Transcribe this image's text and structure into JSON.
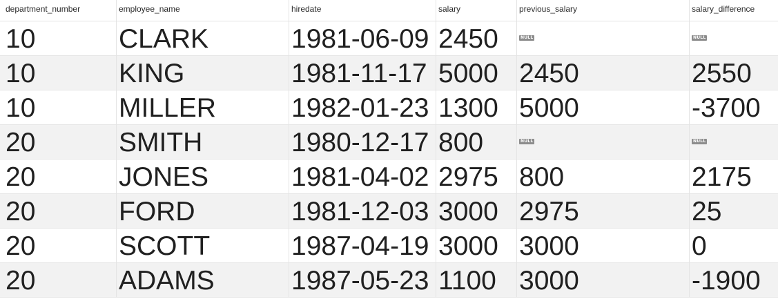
{
  "table": {
    "columns": [
      "department_number",
      "employee_name",
      "hiredate",
      "salary",
      "previous_salary",
      "salary_difference"
    ],
    "null_label": "NULL",
    "rows": [
      [
        "10",
        "CLARK",
        "1981-06-09",
        "2450",
        null,
        null
      ],
      [
        "10",
        "KING",
        "1981-11-17",
        "5000",
        "2450",
        "2550"
      ],
      [
        "10",
        "MILLER",
        "1982-01-23",
        "1300",
        "5000",
        "-3700"
      ],
      [
        "20",
        "SMITH",
        "1980-12-17",
        "800",
        null,
        null
      ],
      [
        "20",
        "JONES",
        "1981-04-02",
        "2975",
        "800",
        "2175"
      ],
      [
        "20",
        "FORD",
        "1981-12-03",
        "3000",
        "2975",
        "25"
      ],
      [
        "20",
        "SCOTT",
        "1987-04-19",
        "3000",
        "3000",
        "0"
      ],
      [
        "20",
        "ADAMS",
        "1987-05-23",
        "1100",
        "3000",
        "-1900"
      ]
    ]
  },
  "colors": {
    "stripe": "#f2f2f2",
    "null_badge": "#8c8c8c"
  }
}
